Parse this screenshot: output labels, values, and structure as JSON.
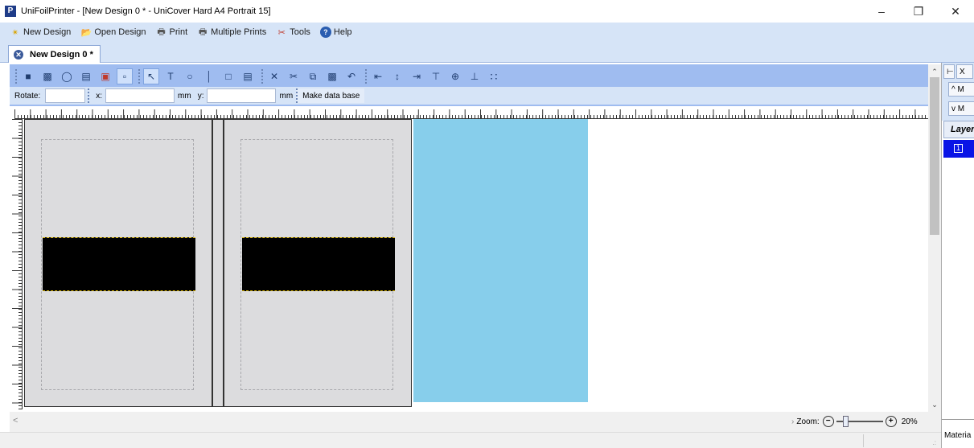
{
  "window": {
    "app_icon": "P",
    "title": "UniFoilPrinter - [New Design 0 * - UniCover Hard A4 Portrait 15]",
    "minimize": "–",
    "restore": "❐",
    "close": "✕"
  },
  "menu": {
    "items": [
      {
        "label": "New Design",
        "icon": "new-design-icon",
        "glyph": "✴"
      },
      {
        "label": "Open Design",
        "icon": "open-folder-icon",
        "glyph": "📂"
      },
      {
        "label": "Print",
        "icon": "print-icon",
        "glyph": "🖶"
      },
      {
        "label": "Multiple Prints",
        "icon": "multiple-prints-icon",
        "glyph": "🖶"
      },
      {
        "label": "Tools",
        "icon": "tools-icon",
        "glyph": "✂"
      },
      {
        "label": "Help",
        "icon": "help-icon",
        "glyph": "?"
      }
    ]
  },
  "doc_tab": {
    "label": "New Design 0 *",
    "close": "✕"
  },
  "toolbar": {
    "rotate_label": "Rotate:",
    "x_label": "x:",
    "mm_label_1": "mm",
    "y_label": "y:",
    "mm_label_2": "mm",
    "make_db_label": "Make data base",
    "rotate_value": "",
    "x_value": "",
    "y_value": ""
  },
  "zoom": {
    "label": "Zoom:",
    "minus": "−",
    "plus": "+",
    "value": "20%",
    "arrow": "›"
  },
  "right_panel": {
    "close_x": "X",
    "up_label": "^ M",
    "down_label": "v M",
    "layer_header": "Layer",
    "layer_number": "1",
    "material_label": "Materia"
  },
  "colors": {
    "menubar": "#d6e4f7",
    "toolbar": "#9fbcf0",
    "page": "#dcdcde",
    "blue_panel": "#87ceeb",
    "layer_selected": "#0a14e6"
  }
}
